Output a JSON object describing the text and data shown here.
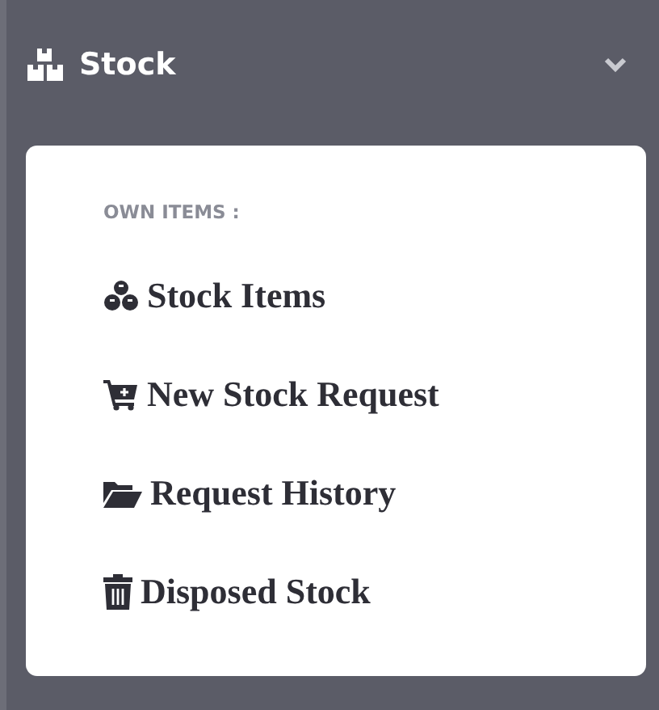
{
  "menu": {
    "title": "Stock",
    "expanded": true,
    "section_label": "OWN ITEMS :",
    "items": [
      {
        "label": "Stock Items"
      },
      {
        "label": "New Stock Request"
      },
      {
        "label": "Request History"
      },
      {
        "label": "Disposed Stock"
      }
    ]
  }
}
